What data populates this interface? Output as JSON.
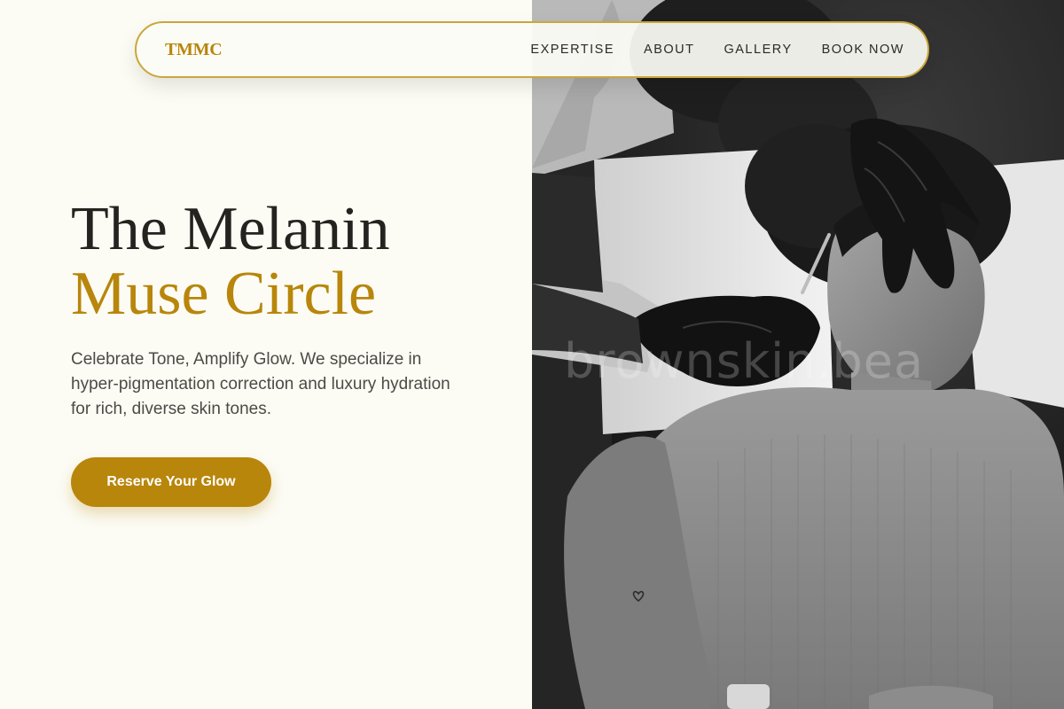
{
  "nav": {
    "brand": "TMMC",
    "links": [
      "EXPERTISE",
      "ABOUT",
      "GALLERY",
      "BOOK NOW"
    ]
  },
  "hero": {
    "title_line1": "The Melanin",
    "title_line2": "Muse Circle",
    "subtitle": "Celebrate Tone, Amplify Glow. We specialize in hyper-pigmentation correction and luxury hydration for rich, diverse skin tones.",
    "cta_label": "Reserve Your Glow"
  },
  "photo": {
    "watermark": "brownskin.bea",
    "alt": "Black-and-white photo of an esthetician in black gloves performing a facial treatment on a client"
  },
  "colors": {
    "background": "#fcfcf5",
    "accent_gold": "#b8860b",
    "nav_border": "#c9a73a",
    "heading_dark": "#24231f",
    "body_text": "#4c4a45"
  },
  "icons": []
}
